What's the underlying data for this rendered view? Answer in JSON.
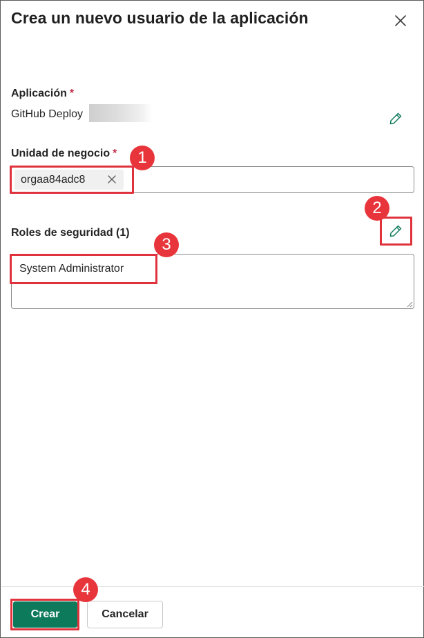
{
  "panel": {
    "title": "Crea un nuevo usuario de la aplicación",
    "close_icon": "close-icon"
  },
  "application": {
    "label": "Aplicación",
    "required_mark": "*",
    "value": "GitHub Deploy",
    "edit_icon": "pencil-icon"
  },
  "business_unit": {
    "label": "Unidad de negocio",
    "required_mark": "*",
    "chip": "orgaa84adc8",
    "remove_icon": "close-icon"
  },
  "security_roles": {
    "label": "Roles de seguridad (1)",
    "edit_icon": "pencil-icon",
    "roles": [
      "System Administrator"
    ]
  },
  "callouts": [
    "1",
    "2",
    "3",
    "4"
  ],
  "footer": {
    "create_label": "Crear",
    "cancel_label": "Cancelar"
  },
  "colors": {
    "primary": "#0e7a5c",
    "required": "#c4314b",
    "callout": "#e8353b"
  }
}
